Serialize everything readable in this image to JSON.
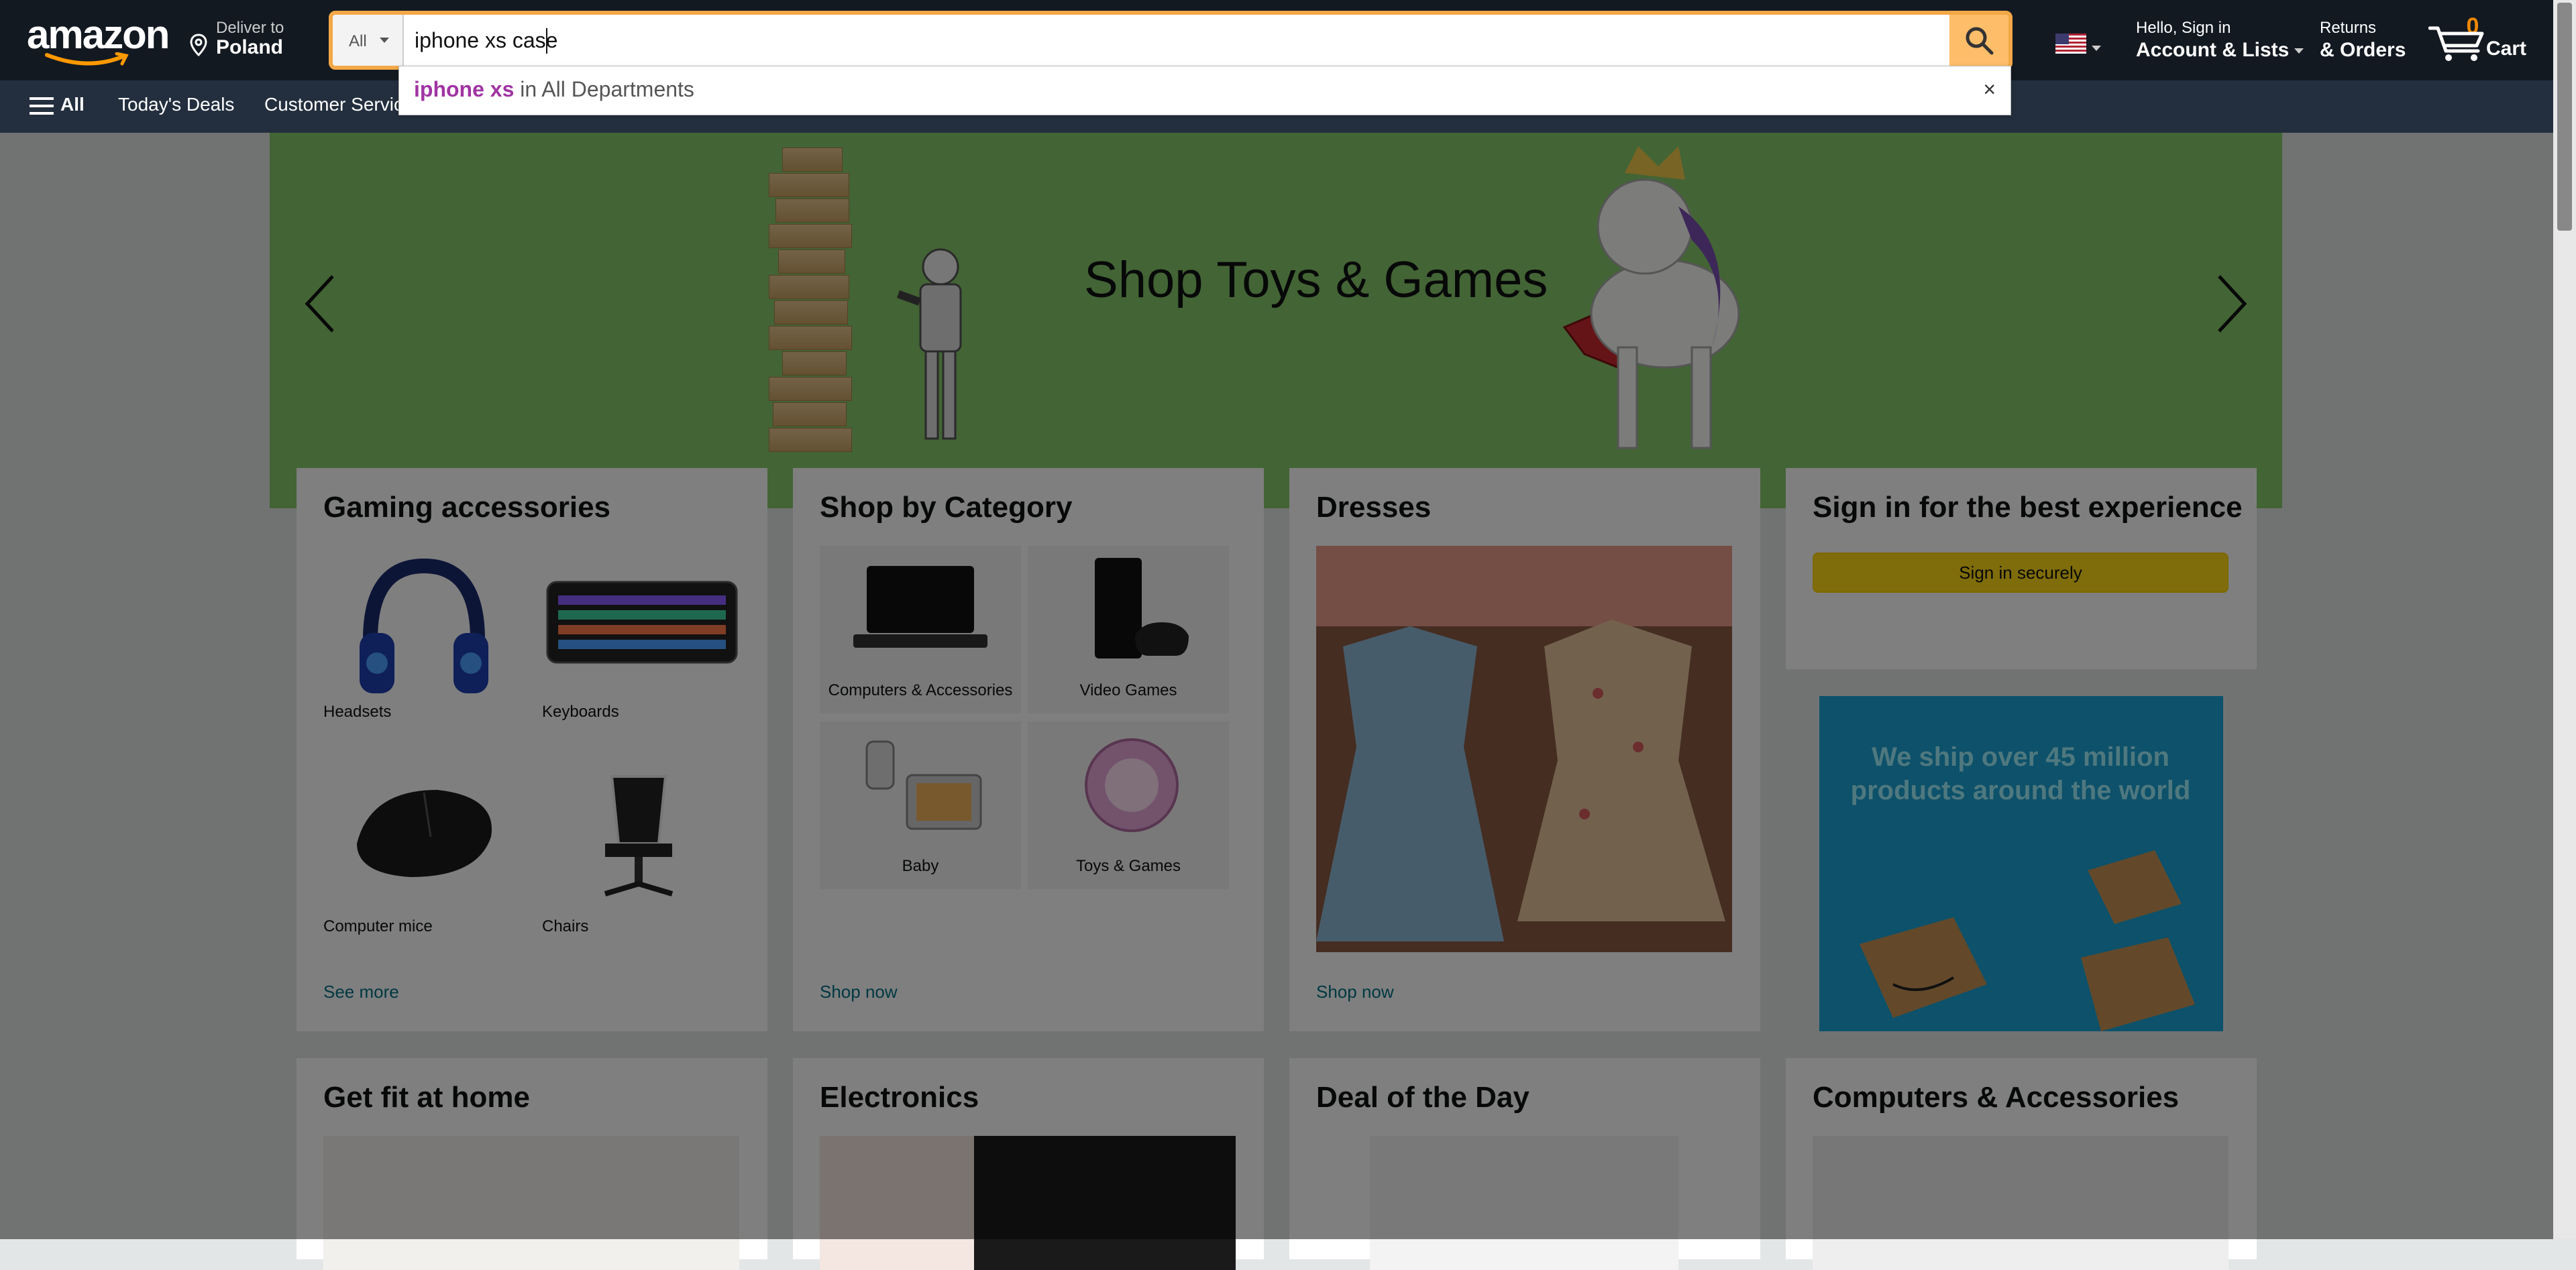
{
  "header": {
    "logo_text": "amazon",
    "deliver_line1": "Deliver to",
    "deliver_line2": "Poland",
    "search_category": "All",
    "search_query": "iphone xs case",
    "account_line1": "Hello, Sign in",
    "account_line2": "Account & Lists",
    "returns_line1": "Returns",
    "returns_line2": "& Orders",
    "cart_count": "0",
    "cart_label": "Cart"
  },
  "subnav": {
    "all_label": "All",
    "items": [
      "Today's Deals",
      "Customer Service"
    ]
  },
  "autocomplete": {
    "bold_part": "iphone xs",
    "rest": " in All Departments",
    "close": "×"
  },
  "hero": {
    "title": "Shop Toys & Games"
  },
  "cards": {
    "gaming": {
      "title": "Gaming accessories",
      "items": [
        "Headsets",
        "Keyboards",
        "Computer mice",
        "Chairs"
      ],
      "link": "See more"
    },
    "category": {
      "title": "Shop by Category",
      "items": [
        "Computers & Accessories",
        "Video Games",
        "Baby",
        "Toys & Games"
      ],
      "link": "Shop now"
    },
    "dresses": {
      "title": "Dresses",
      "link": "Shop now"
    },
    "signin": {
      "title": "Sign in for the best experience",
      "button": "Sign in securely"
    },
    "ship_banner": "We ship over 45 million products around the world",
    "row2_titles": [
      "Get fit at home",
      "Electronics",
      "Deal of the Day",
      "Computers & Accessories"
    ]
  },
  "colors": {
    "nav_bg": "#131921",
    "subnav_bg": "#232f3e",
    "search_button": "#febd69",
    "link": "#007185",
    "hero_bg": "#86c86a",
    "signin_button": "#ffd814"
  }
}
